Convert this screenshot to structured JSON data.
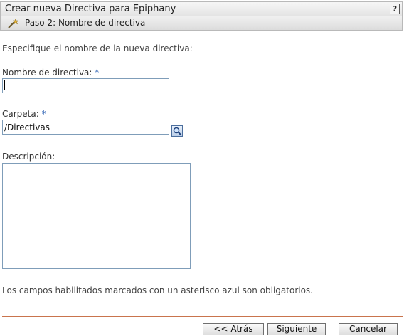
{
  "window": {
    "title": "Crear nueva Directiva para Epiphany",
    "help_label": "?"
  },
  "step": {
    "title": "Paso 2: Nombre de directiva",
    "icon": "wizard-wand-icon"
  },
  "form": {
    "intro": "Especifique el nombre de la nueva directiva:",
    "name_label": "Nombre de directiva:",
    "name_required": "*",
    "name_value": "",
    "folder_label": "Carpeta:",
    "folder_required": "*",
    "folder_value": "/Directivas",
    "browse_icon": "search-icon",
    "description_label": "Descripción:",
    "description_value": ""
  },
  "footer": {
    "required_note": "Los campos habilitados marcados con un asterisco azul son obligatorios.",
    "back_label": "<< Atrás",
    "next_label": "Siguiente >>",
    "cancel_label": "Cancelar"
  },
  "colors": {
    "required_asterisk": "#2f63b5",
    "divider": "#c9744d"
  }
}
